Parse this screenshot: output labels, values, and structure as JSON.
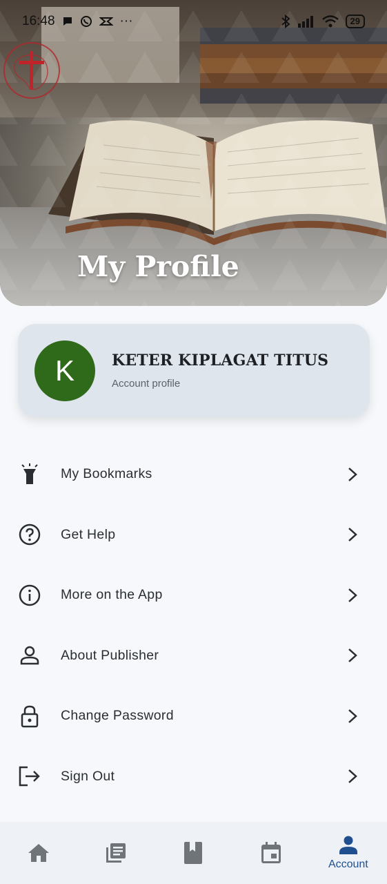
{
  "status_bar": {
    "time": "16:48",
    "notif_icons": [
      "chat-bubble-icon",
      "whatsapp-icon",
      "capcut-icon",
      "more-dots-icon"
    ],
    "right_icons": [
      "bluetooth-icon",
      "signal-icon",
      "wifi-icon"
    ],
    "battery": "29"
  },
  "header": {
    "title": "My Profile"
  },
  "profile": {
    "avatar_letter": "K",
    "name": "KETER KIPLAGAT TITUS",
    "subtitle": "Account profile",
    "avatar_color": "#2f6a1b"
  },
  "menu": [
    {
      "label": "My Bookmarks",
      "icon": "flashlight-icon"
    },
    {
      "label": "Get Help",
      "icon": "help-circle-icon"
    },
    {
      "label": "More on the App",
      "icon": "info-circle-icon"
    },
    {
      "label": "About Publisher",
      "icon": "person-icon"
    },
    {
      "label": "Change Password",
      "icon": "lock-icon"
    },
    {
      "label": "Sign Out",
      "icon": "logout-icon"
    }
  ],
  "bottom_nav": [
    {
      "icon": "home-icon",
      "label": ""
    },
    {
      "icon": "library-icon",
      "label": ""
    },
    {
      "icon": "bookmark-book-icon",
      "label": ""
    },
    {
      "icon": "calendar-icon",
      "label": ""
    },
    {
      "icon": "account-icon",
      "label": "Account",
      "active": true
    }
  ],
  "colors": {
    "accent": "#1f4f8f",
    "background": "#f6f8fb",
    "card": "#dfe5ec"
  }
}
